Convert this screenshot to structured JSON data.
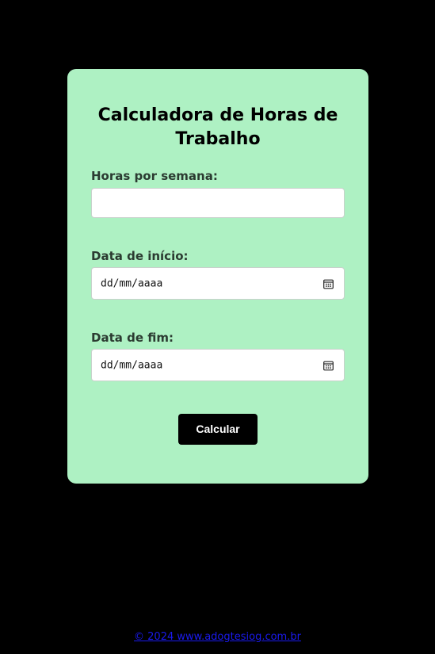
{
  "form": {
    "title_line1": "Calculadora de Horas de",
    "title_line2": "Trabalho",
    "hours_label": "Horas por semana:",
    "hours_value": "",
    "start_label": "Data de início:",
    "start_value": "dd/mm/aaaa",
    "end_label": "Data de fim:",
    "end_value": "dd/mm/aaaa",
    "submit_label": "Calcular"
  },
  "footer": {
    "link_text": "© 2024 www.adogtesiog.com.br"
  },
  "colors": {
    "page_background": "#000000",
    "card_background": "#aef1c3",
    "button_background": "#000000",
    "link": "#1a1aee"
  }
}
